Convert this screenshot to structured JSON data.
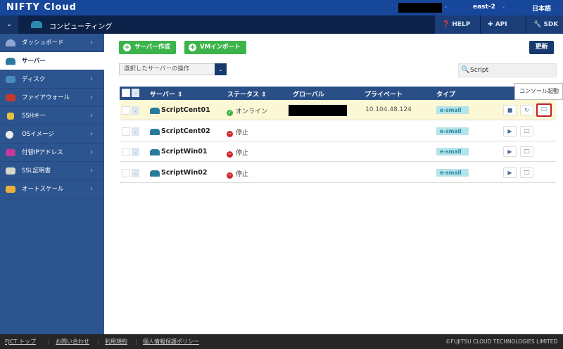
{
  "header": {
    "brand": "NIFTY Cloud",
    "region": "east-2",
    "language": "日本語"
  },
  "service_bar": {
    "service": "コンピューティング",
    "buttons": [
      {
        "label": "HELP",
        "icon": "question-icon"
      },
      {
        "label": "API",
        "icon": "puzzle-icon"
      },
      {
        "label": "SDK",
        "icon": "wrench-icon"
      }
    ]
  },
  "sidebar": {
    "items": [
      {
        "label": "ダッシュボード",
        "active": false
      },
      {
        "label": "サーバー",
        "active": true
      },
      {
        "label": "ディスク",
        "active": false
      },
      {
        "label": "ファイアウォール",
        "active": false
      },
      {
        "label": "SSHキー",
        "active": false
      },
      {
        "label": "OSイメージ",
        "active": false
      },
      {
        "label": "付替IPアドレス",
        "active": false
      },
      {
        "label": "SSL証明書",
        "active": false
      },
      {
        "label": "オートスケール",
        "active": false
      }
    ]
  },
  "toolbar": {
    "create_server": "サーバー作成",
    "vm_import": "VMインポート",
    "refresh": "更新",
    "bulk_action": "選択したサーバーの操作",
    "search_value": "Script"
  },
  "table": {
    "headers": [
      "サーバー",
      "ステータス",
      "グローバル",
      "プライベート",
      "タイプ"
    ],
    "rows": [
      {
        "name": "ScriptCent01",
        "status": "オンライン",
        "private": "10.104.48.124",
        "type": "e-small"
      },
      {
        "name": "ScriptCent02",
        "status": "停止",
        "private": "",
        "type": "e-small"
      },
      {
        "name": "ScriptWin01",
        "status": "停止",
        "private": "",
        "type": "e-small"
      },
      {
        "name": "ScriptWin02",
        "status": "停止",
        "private": "",
        "type": "e-small"
      }
    ]
  },
  "tooltip": "コンソール起動",
  "footer": {
    "links": [
      "FJCT トップ",
      "お問い合わせ",
      "利用規約",
      "個人情報保護ポリシー"
    ],
    "copyright": "©FUJITSU CLOUD TECHNOLOGIES LIMITED"
  },
  "colors": {
    "header": "#17479a",
    "sidebar": "#2c5590",
    "green": "#3cb44b",
    "online": "#3cb44b",
    "stopped": "#d0282e",
    "highlight": "#fcf8d6"
  }
}
